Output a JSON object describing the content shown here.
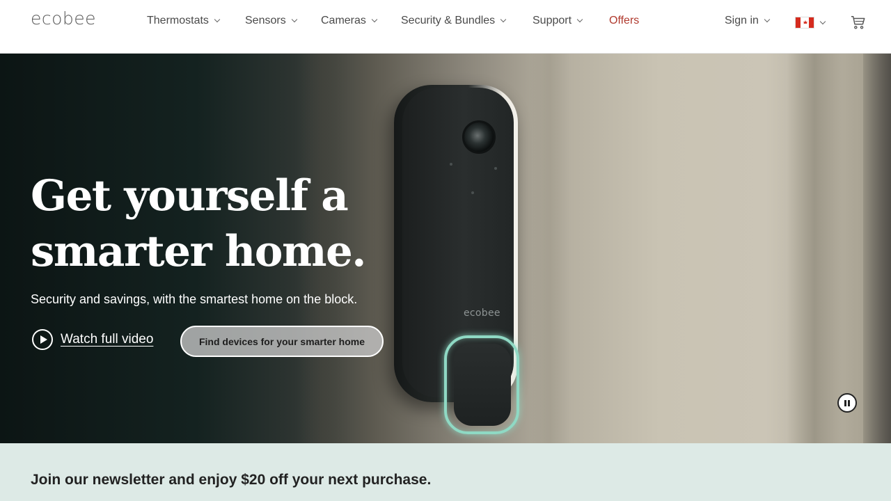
{
  "header": {
    "logo": "ecobee",
    "nav": [
      {
        "label": "Thermostats",
        "has_menu": true
      },
      {
        "label": "Sensors",
        "has_menu": true
      },
      {
        "label": "Cameras",
        "has_menu": true
      },
      {
        "label": "Security & Bundles",
        "has_menu": true
      },
      {
        "label": "Support",
        "has_menu": true
      },
      {
        "label": "Offers",
        "has_menu": false
      }
    ],
    "sign_in": "Sign in",
    "country_flag": "canada-flag-icon",
    "cart_icon": "cart-icon"
  },
  "hero": {
    "title_line1": "Get yourself a",
    "title_line2": "smarter home.",
    "subtitle": "Security and savings, with the smartest home on the block.",
    "watch_label": "Watch full video",
    "cta_label": "Find devices for your smarter home",
    "device_brand": "ecobee",
    "play_icon": "play-icon",
    "pause_icon": "pause-icon"
  },
  "newsletter": {
    "heading": "Join our newsletter and enjoy $20 off your next purchase."
  },
  "colors": {
    "offers": "#b03a2e",
    "ring_glow": "#8fd9c4",
    "newsletter_bg": "#ddeae6"
  }
}
